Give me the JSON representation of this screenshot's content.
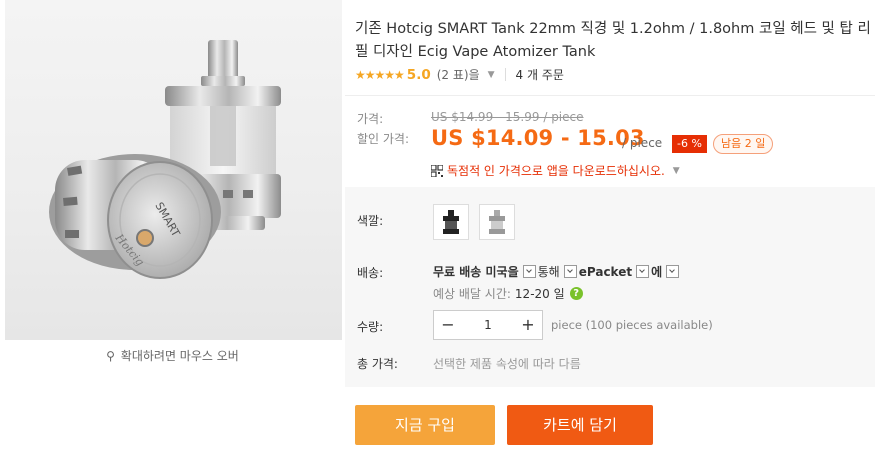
{
  "product": {
    "title": "기존 Hotcig SMART Tank 22mm 직경 및 1.2ohm / 1.8ohm 코일 헤드 및 탑 리필 디자인 Ecig Vape Atomizer Tank",
    "image_brand_text": "SMART",
    "zoom_hint": "확대하려면 마우스 오버"
  },
  "rating": {
    "stars": "★★★★★",
    "score": "5.0",
    "reviews": "(2 표)을",
    "orders": "4 개 주문"
  },
  "price": {
    "original_label": "가격:",
    "original_value": "US $14.99 - 15.99 / piece",
    "discount_label": "할인 가격:",
    "discount_value": "US $14.09 - 15.03",
    "per_piece": "/ piece",
    "discount_pct": "-6 %",
    "remaining": "남음 2 일",
    "app_promo": "독점적 인 가격으로 앱을 다운로드하십시오."
  },
  "options": {
    "color_label": "색깔:",
    "shipping_label": "배송:",
    "shipping_free": "무료 배송 미국을",
    "shipping_via": "통해",
    "shipping_method": "ePacket",
    "shipping_suffix": "에",
    "eta_label": "예상 배달 시간:",
    "eta_days": "12-20 일",
    "qty_label": "수량:",
    "qty_value": "1",
    "qty_minus": "−",
    "qty_plus": "+",
    "available": "piece (100 pieces available)",
    "total_label": "총 가격:",
    "total_value": "선택한 제품 속성에 따라 다름"
  },
  "actions": {
    "buy_now": "지금 구입",
    "add_to_cart": "카트에 담기"
  },
  "colors": {
    "accent_orange": "#f56a14",
    "buy_button": "#f5a43a",
    "cart_button": "#f05a13",
    "badge_red": "#e62e04",
    "star": "#f5a623"
  }
}
